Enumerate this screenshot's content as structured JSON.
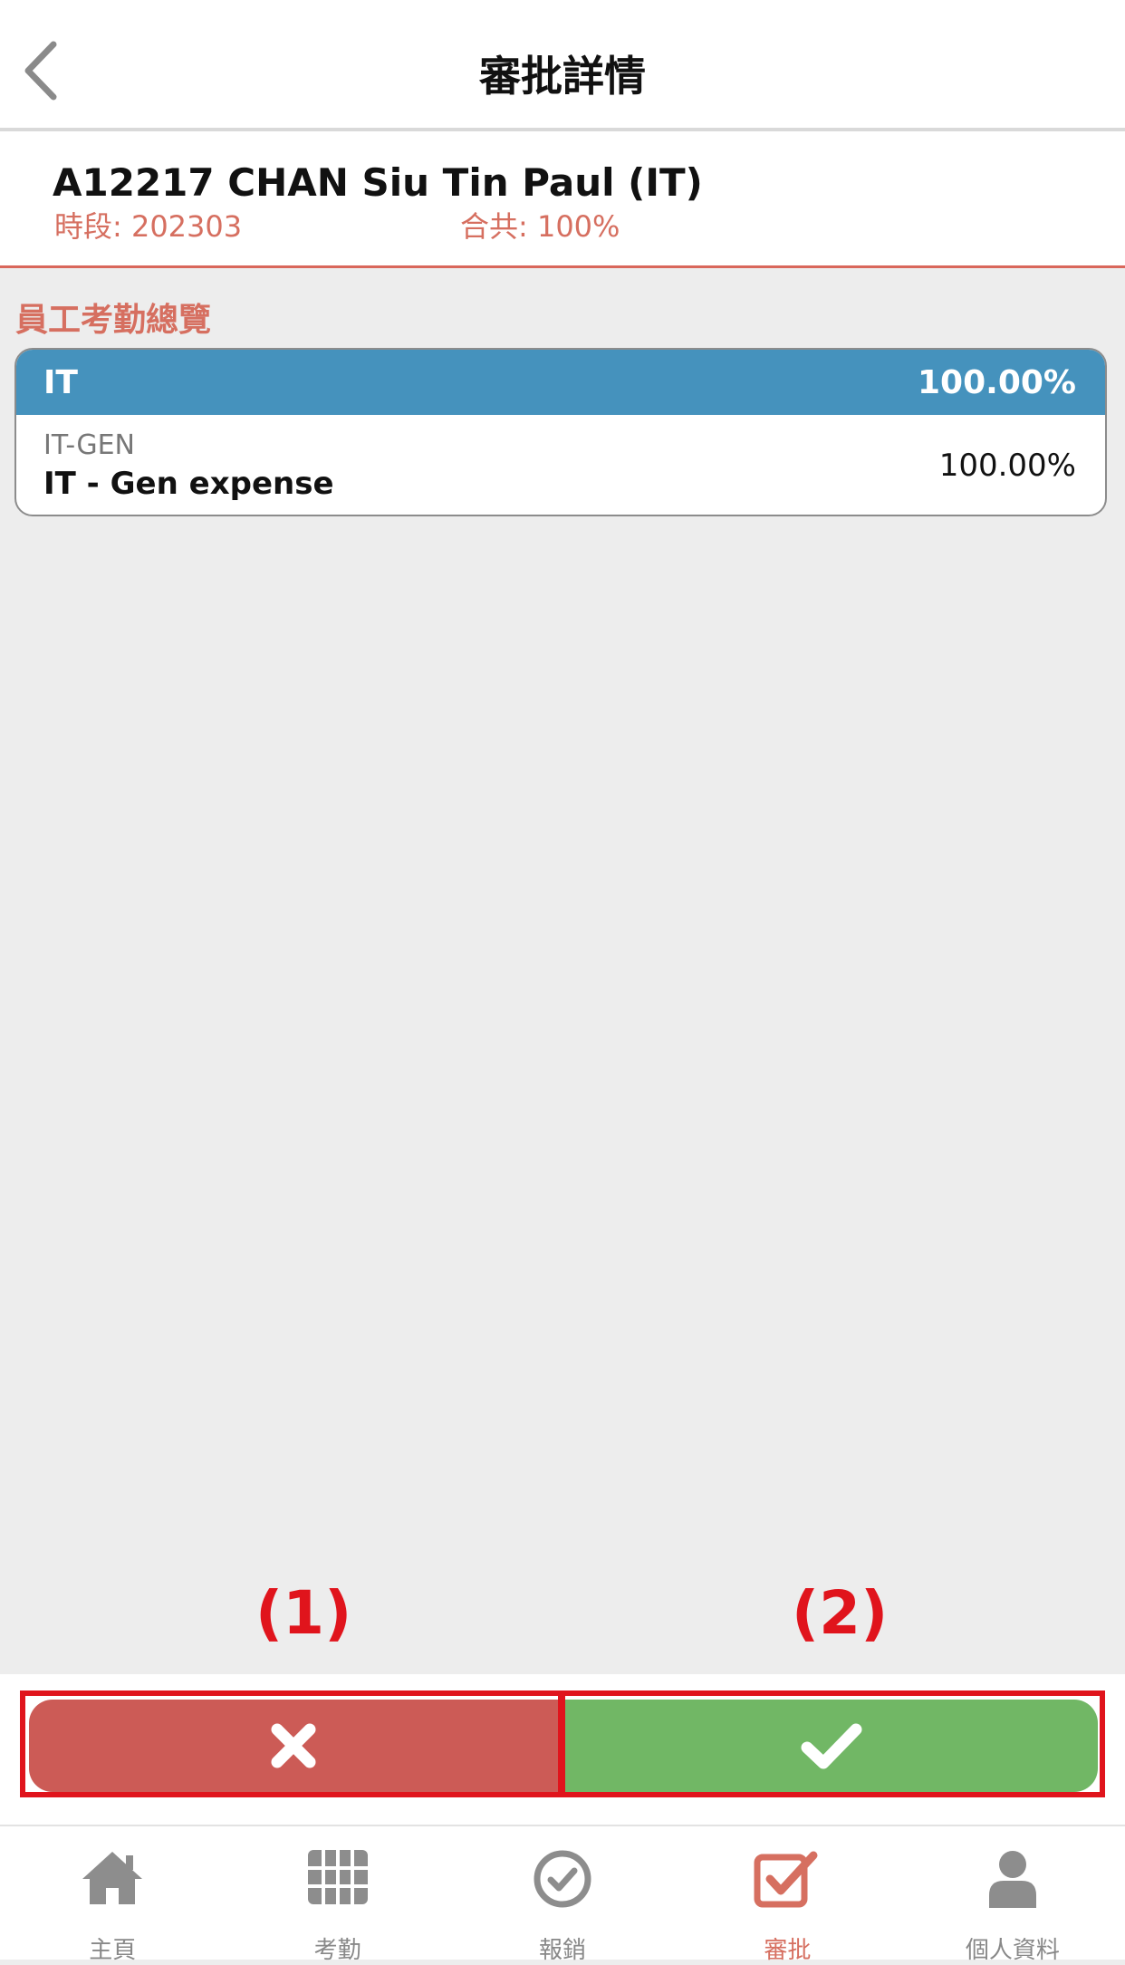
{
  "header": {
    "title": "審批詳情",
    "back_icon": "chevron-left-icon"
  },
  "employee": {
    "name": "A12217 CHAN Siu Tin Paul (IT)",
    "period": "時段: 202303",
    "total": "合共: 100%"
  },
  "section": {
    "title": "員工考勤總覽"
  },
  "card": {
    "header_label": "IT",
    "header_value": "100.00%",
    "rows": [
      {
        "code": "IT-GEN",
        "description": "IT - Gen expense",
        "value": "100.00%"
      }
    ]
  },
  "annotations": {
    "marker_1": "(1)",
    "marker_2": "(2)"
  },
  "actions": {
    "reject_icon": "close-icon",
    "approve_icon": "check-icon",
    "reject_color": "#cc5b56",
    "approve_color": "#71b765"
  },
  "tabs": [
    {
      "label": "主頁",
      "icon": "home-icon",
      "active": false
    },
    {
      "label": "考勤",
      "icon": "grid-icon",
      "active": false
    },
    {
      "label": "報銷",
      "icon": "check-circle-icon",
      "active": false
    },
    {
      "label": "審批",
      "icon": "checkbox-icon",
      "active": true
    },
    {
      "label": "個人資料",
      "icon": "person-icon",
      "active": false
    }
  ],
  "colors": {
    "accent": "#d66f60",
    "card_header": "#4592bd",
    "highlight": "#e0141c"
  }
}
